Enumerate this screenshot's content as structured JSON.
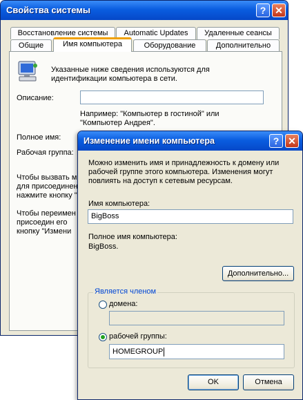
{
  "system_props": {
    "title": "Свойства системы",
    "tabs_row1": [
      "Восстановление системы",
      "Automatic Updates",
      "Удаленные сеансы"
    ],
    "tabs_row2": [
      "Общие",
      "Имя компьютера",
      "Оборудование",
      "Дополнительно"
    ],
    "info_text_1": "Указанные ниже сведения используются для",
    "info_text_2": "идентификации компьютера в сети.",
    "description_label": "Описание:",
    "description_value": "",
    "example_1": "Например: \"Компьютер в гостиной\" или",
    "example_2": "\"Компьютер Андрея\".",
    "fullname_label": "Полное имя:",
    "workgroup_label": "Рабочая группа:",
    "para1_1": "Чтобы вызвать м",
    "para1_2": "для присоединен",
    "para1_3": "нажмите кнопку \"",
    "para2_1": "Чтобы переимен",
    "para2_2": "присоедин его",
    "para2_3": "кнопку \"Измени"
  },
  "rename_dialog": {
    "title": "Изменение имени компьютера",
    "info_1": "Можно изменить имя и принадлежность к домену или",
    "info_2": "рабочей группе этого компьютера. Изменения могут",
    "info_3": "повлиять на доступ к сетевым ресурсам.",
    "computer_name_label": "Имя компьютера:",
    "computer_name_value": "BigBoss",
    "full_name_label": "Полное имя компьютера:",
    "full_name_value": "BigBoss.",
    "more_button": "Дополнительно...",
    "member_of_label": "Является членом",
    "domain_label": "домена:",
    "domain_value": "",
    "workgroup_label": "рабочей группы:",
    "workgroup_value": "HOMEGROUP",
    "ok_button": "OK",
    "cancel_button": "Отмена",
    "membership": "workgroup"
  },
  "colors": {
    "title_blue": "#0a5de0",
    "groupbox_text": "#0046d5",
    "active_tab_accent": "#f0a000"
  }
}
